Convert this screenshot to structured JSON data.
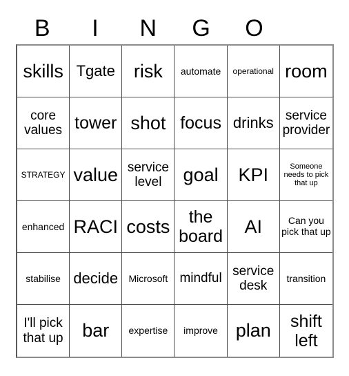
{
  "card": {
    "title": "BINGO",
    "header_letters": [
      "B",
      "I",
      "N",
      "G",
      "O",
      ""
    ],
    "columns": 6,
    "rows": 6,
    "grid_line_color": "#4d4d4d",
    "background_color": "#ffffff",
    "text_color": "#000000"
  },
  "cells": [
    [
      {
        "text": "skills",
        "size": "fs-xxl"
      },
      {
        "text": "Tgate",
        "size": "fs-l"
      },
      {
        "text": "risk",
        "size": "fs-xxl"
      },
      {
        "text": "automate",
        "size": "fs-s"
      },
      {
        "text": "operational",
        "size": "fs-xs"
      },
      {
        "text": "room",
        "size": "fs-xxl"
      }
    ],
    [
      {
        "text": "core values",
        "size": "fs-m"
      },
      {
        "text": "tower",
        "size": "fs-xl"
      },
      {
        "text": "shot",
        "size": "fs-xxl"
      },
      {
        "text": "focus",
        "size": "fs-xl"
      },
      {
        "text": "drinks",
        "size": "fs-l"
      },
      {
        "text": "service provider",
        "size": "fs-m"
      }
    ],
    [
      {
        "text": "STRATEGY",
        "size": "fs-xs"
      },
      {
        "text": "value",
        "size": "fs-xxl"
      },
      {
        "text": "service level",
        "size": "fs-m"
      },
      {
        "text": "goal",
        "size": "fs-xxl"
      },
      {
        "text": "KPI",
        "size": "fs-xxl"
      },
      {
        "text": "Someone needs to pick that up",
        "size": "fs-xxs"
      }
    ],
    [
      {
        "text": "enhanced",
        "size": "fs-s"
      },
      {
        "text": "RACI",
        "size": "fs-xxl"
      },
      {
        "text": "costs",
        "size": "fs-xxl"
      },
      {
        "text": "the board",
        "size": "fs-xl"
      },
      {
        "text": "AI",
        "size": "fs-xxl"
      },
      {
        "text": "Can you pick that up",
        "size": "fs-s"
      }
    ],
    [
      {
        "text": "stabilise",
        "size": "fs-s"
      },
      {
        "text": "decide",
        "size": "fs-l"
      },
      {
        "text": "Microsoft",
        "size": "fs-s"
      },
      {
        "text": "mindful",
        "size": "fs-m"
      },
      {
        "text": "service desk",
        "size": "fs-m"
      },
      {
        "text": "transition",
        "size": "fs-s"
      }
    ],
    [
      {
        "text": "I'll pick that up",
        "size": "fs-m"
      },
      {
        "text": "bar",
        "size": "fs-xxl"
      },
      {
        "text": "expertise",
        "size": "fs-s"
      },
      {
        "text": "improve",
        "size": "fs-s"
      },
      {
        "text": "plan",
        "size": "fs-xxl"
      },
      {
        "text": "shift left",
        "size": "fs-xl"
      }
    ]
  ]
}
